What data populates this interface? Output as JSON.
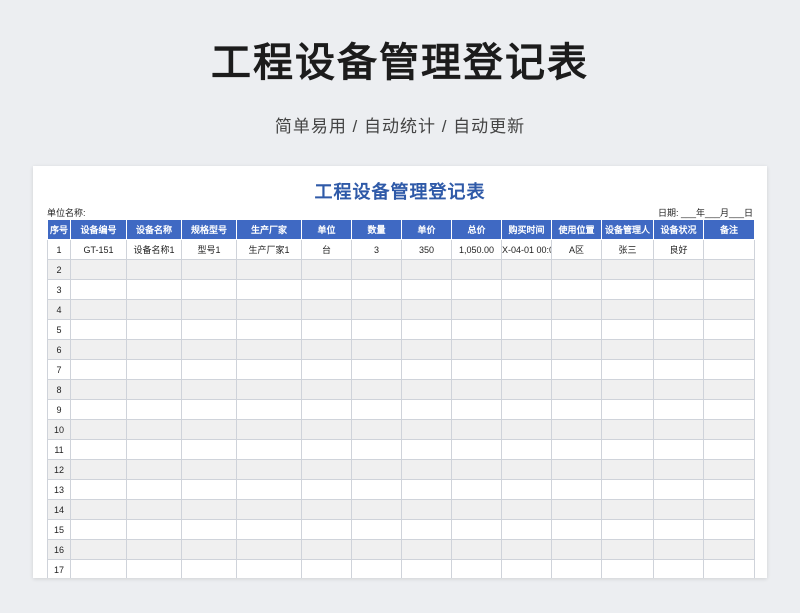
{
  "header": {
    "title": "工程设备管理登记表",
    "subtitle": "简单易用 / 自动统计 / 自动更新"
  },
  "sheet": {
    "title": "工程设备管理登记表",
    "unit_label": "单位名称:",
    "date_label": "日期: ___年___月___日",
    "columns": [
      "序号",
      "设备编号",
      "设备名称",
      "规格型号",
      "生产厂家",
      "单位",
      "数量",
      "单价",
      "总价",
      "购买时间",
      "使用位置",
      "设备管理人",
      "设备状况",
      "备注"
    ],
    "rows": [
      [
        "1",
        "GT-151",
        "设备名称1",
        "型号1",
        "生产厂家1",
        "台",
        "3",
        "350",
        "1,050.00",
        "X-04-01 00:0",
        "A区",
        "张三",
        "良好",
        ""
      ],
      [
        "2",
        "",
        "",
        "",
        "",
        "",
        "",
        "",
        "",
        "",
        "",
        "",
        "",
        ""
      ],
      [
        "3",
        "",
        "",
        "",
        "",
        "",
        "",
        "",
        "",
        "",
        "",
        "",
        "",
        ""
      ],
      [
        "4",
        "",
        "",
        "",
        "",
        "",
        "",
        "",
        "",
        "",
        "",
        "",
        "",
        ""
      ],
      [
        "5",
        "",
        "",
        "",
        "",
        "",
        "",
        "",
        "",
        "",
        "",
        "",
        "",
        ""
      ],
      [
        "6",
        "",
        "",
        "",
        "",
        "",
        "",
        "",
        "",
        "",
        "",
        "",
        "",
        ""
      ],
      [
        "7",
        "",
        "",
        "",
        "",
        "",
        "",
        "",
        "",
        "",
        "",
        "",
        "",
        ""
      ],
      [
        "8",
        "",
        "",
        "",
        "",
        "",
        "",
        "",
        "",
        "",
        "",
        "",
        "",
        ""
      ],
      [
        "9",
        "",
        "",
        "",
        "",
        "",
        "",
        "",
        "",
        "",
        "",
        "",
        "",
        ""
      ],
      [
        "10",
        "",
        "",
        "",
        "",
        "",
        "",
        "",
        "",
        "",
        "",
        "",
        "",
        ""
      ],
      [
        "11",
        "",
        "",
        "",
        "",
        "",
        "",
        "",
        "",
        "",
        "",
        "",
        "",
        ""
      ],
      [
        "12",
        "",
        "",
        "",
        "",
        "",
        "",
        "",
        "",
        "",
        "",
        "",
        "",
        ""
      ],
      [
        "13",
        "",
        "",
        "",
        "",
        "",
        "",
        "",
        "",
        "",
        "",
        "",
        "",
        ""
      ],
      [
        "14",
        "",
        "",
        "",
        "",
        "",
        "",
        "",
        "",
        "",
        "",
        "",
        "",
        ""
      ],
      [
        "15",
        "",
        "",
        "",
        "",
        "",
        "",
        "",
        "",
        "",
        "",
        "",
        "",
        ""
      ],
      [
        "16",
        "",
        "",
        "",
        "",
        "",
        "",
        "",
        "",
        "",
        "",
        "",
        "",
        ""
      ],
      [
        "17",
        "",
        "",
        "",
        "",
        "",
        "",
        "",
        "",
        "",
        "",
        "",
        "",
        ""
      ]
    ]
  },
  "colors": {
    "header_bg": "#3f69c3",
    "sheet_title": "#2f5aa8",
    "stripe": "#f0f0f0"
  }
}
